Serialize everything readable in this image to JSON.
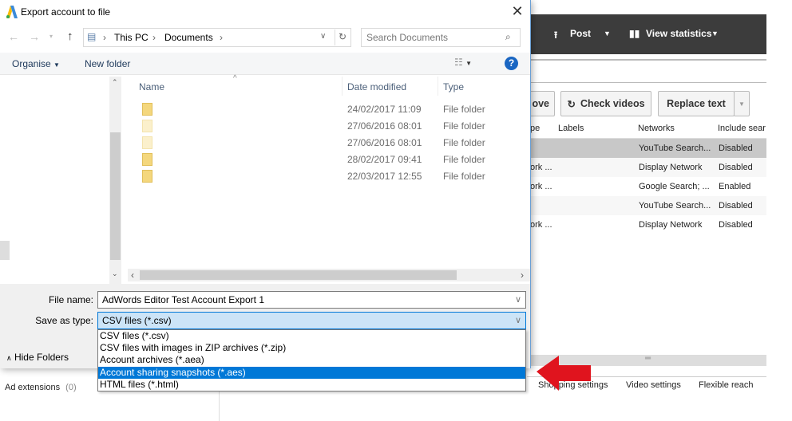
{
  "app": {
    "toolbar": {
      "post": "Post",
      "view_statistics": "View statistics"
    },
    "buttons": {
      "remove_partial": "ove",
      "check_videos": "Check videos",
      "replace_text": "Replace text"
    },
    "grid": {
      "headers": [
        "pe",
        "Labels",
        "Networks",
        "Include sear"
      ],
      "rows": [
        {
          "type": "",
          "networks": "YouTube Search...",
          "include": "Disabled"
        },
        {
          "type": "ork ...",
          "networks": "Display Network",
          "include": "Disabled"
        },
        {
          "type": "ork ...",
          "networks": "Google Search; ...",
          "include": "Enabled"
        },
        {
          "type": "",
          "networks": "YouTube Search...",
          "include": "Disabled"
        },
        {
          "type": "ork ...",
          "networks": "Display Network",
          "include": "Disabled"
        }
      ]
    },
    "bottom_tabs": [
      "Shopping settings",
      "Video settings",
      "Flexible reach"
    ],
    "ad_extensions": "Ad extensions",
    "ad_extensions_count": "(0)"
  },
  "dialog": {
    "title": "Export account to file",
    "breadcrumb": [
      "This PC",
      "Documents"
    ],
    "search_placeholder": "Search Documents",
    "organise": "Organise",
    "new_folder": "New folder",
    "columns": {
      "name": "Name",
      "date": "Date modified",
      "type": "Type"
    },
    "files": [
      {
        "date": "24/02/2017 11:09",
        "type": "File folder",
        "faded": false
      },
      {
        "date": "27/06/2016 08:01",
        "type": "File folder",
        "faded": true
      },
      {
        "date": "27/06/2016 08:01",
        "type": "File folder",
        "faded": true
      },
      {
        "date": "28/02/2017 09:41",
        "type": "File folder",
        "faded": false
      },
      {
        "date": "22/03/2017 12:55",
        "type": "File folder",
        "faded": false
      }
    ],
    "file_name_label": "File name:",
    "file_name_value": "AdWords Editor Test Account Export 1",
    "save_type_label": "Save as type:",
    "save_type_value": "CSV files (*.csv)",
    "save_type_options": [
      "CSV files (*.csv)",
      "CSV files with images in ZIP archives (*.zip)",
      "Account archives (*.aea)",
      "Account sharing snapshots (*.aes)",
      "HTML files (*.html)"
    ],
    "highlighted_option": 3,
    "hide_folders": "Hide Folders"
  },
  "colors": {
    "accent": "#0078d7",
    "arrow": "#e0141e",
    "toolbar": "#3c3c3c"
  }
}
